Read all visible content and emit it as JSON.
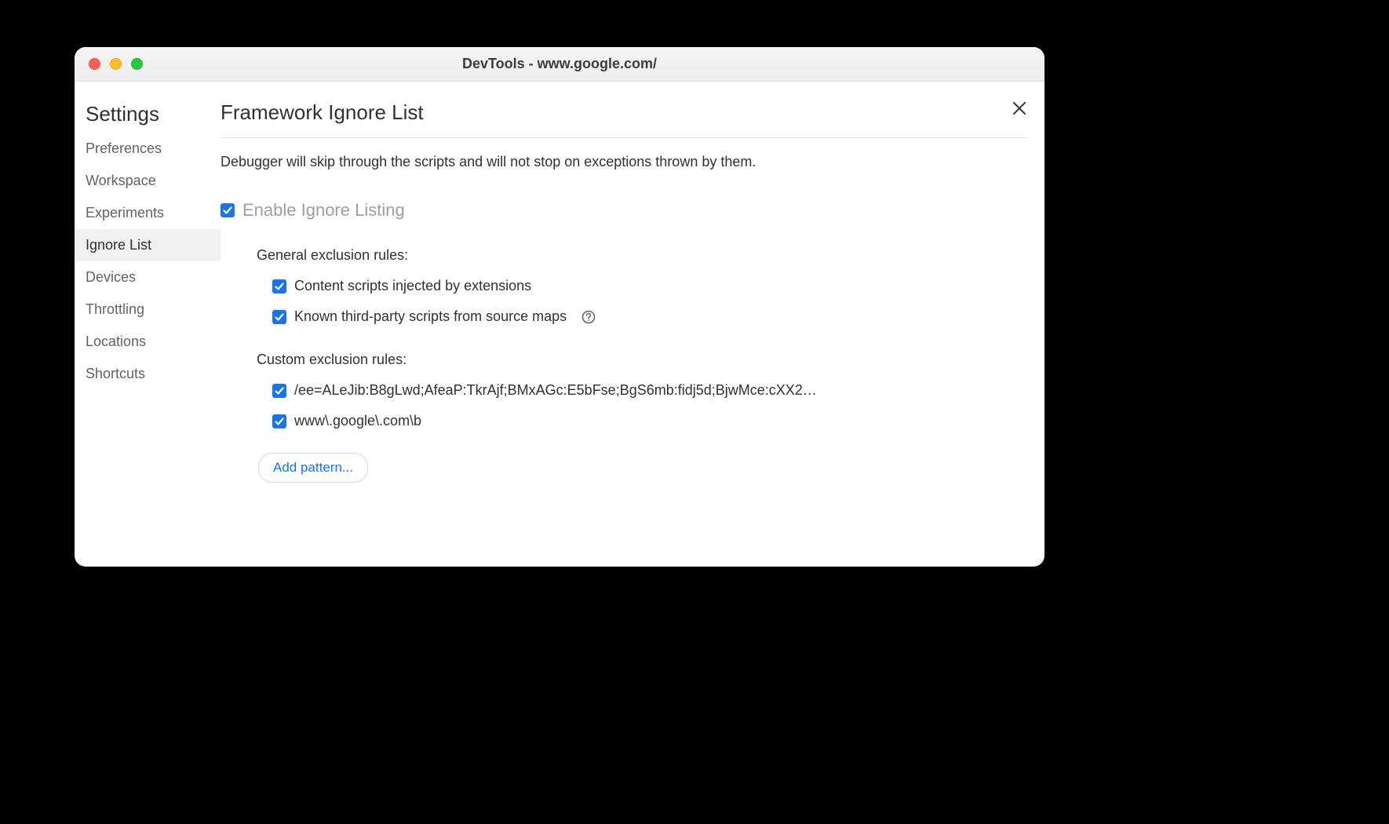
{
  "titlebar": {
    "title": "DevTools - www.google.com/"
  },
  "sidebar": {
    "title": "Settings",
    "items": [
      {
        "label": "Preferences",
        "active": false
      },
      {
        "label": "Workspace",
        "active": false
      },
      {
        "label": "Experiments",
        "active": false
      },
      {
        "label": "Ignore List",
        "active": true
      },
      {
        "label": "Devices",
        "active": false
      },
      {
        "label": "Throttling",
        "active": false
      },
      {
        "label": "Locations",
        "active": false
      },
      {
        "label": "Shortcuts",
        "active": false
      }
    ]
  },
  "main": {
    "title": "Framework Ignore List",
    "description": "Debugger will skip through the scripts and will not stop on exceptions thrown by them.",
    "enable_checked": true,
    "enable_label": "Enable Ignore Listing",
    "general_rules_label": "General exclusion rules:",
    "general_rules": [
      {
        "checked": true,
        "label": "Content scripts injected by extensions",
        "help": false
      },
      {
        "checked": true,
        "label": "Known third-party scripts from source maps",
        "help": true
      }
    ],
    "custom_rules_label": "Custom exclusion rules:",
    "custom_rules": [
      {
        "checked": true,
        "pattern": "/ee=ALeJib:B8gLwd;AfeaP:TkrAjf;BMxAGc:E5bFse;BgS6mb:fidj5d;BjwMce:cXX2…"
      },
      {
        "checked": true,
        "pattern": "www\\.google\\.com\\b"
      }
    ],
    "add_pattern_label": "Add pattern..."
  }
}
